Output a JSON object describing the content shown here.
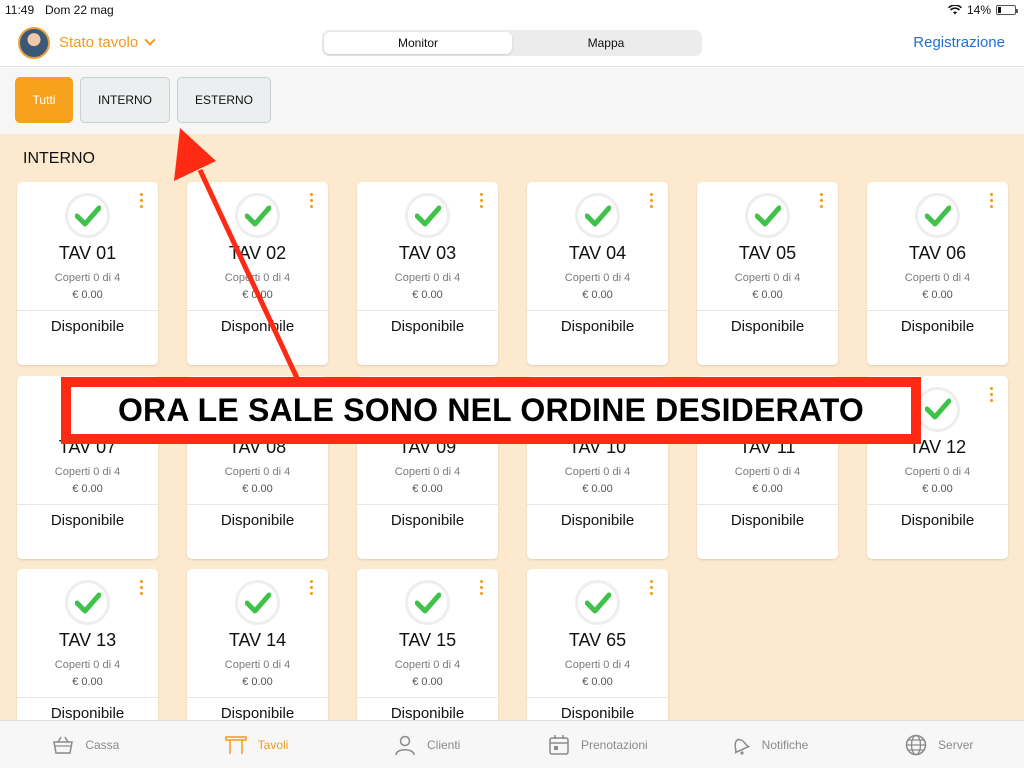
{
  "status_bar": {
    "time": "11:49",
    "date": "Dom 22 mag",
    "battery": "14%"
  },
  "header": {
    "title": "Stato tavolo",
    "segments": [
      {
        "label": "Monitor",
        "active": true
      },
      {
        "label": "Mappa",
        "active": false
      }
    ],
    "action": "Registrazione"
  },
  "filters": [
    {
      "label": "Tutti",
      "active": true
    },
    {
      "label": "INTERNO",
      "active": false
    },
    {
      "label": "ESTERNO",
      "active": false
    }
  ],
  "section": {
    "title": "INTERNO"
  },
  "tables": [
    {
      "name": "TAV 01",
      "coperti": "Coperti 0 di 4",
      "amount": "€ 0.00",
      "status": "Disponibile"
    },
    {
      "name": "TAV 02",
      "coperti": "Coperti 0 di 4",
      "amount": "€ 0.00",
      "status": "Disponibile"
    },
    {
      "name": "TAV 03",
      "coperti": "Coperti 0 di 4",
      "amount": "€ 0.00",
      "status": "Disponibile"
    },
    {
      "name": "TAV 04",
      "coperti": "Coperti 0 di 4",
      "amount": "€ 0.00",
      "status": "Disponibile"
    },
    {
      "name": "TAV 05",
      "coperti": "Coperti 0 di 4",
      "amount": "€ 0.00",
      "status": "Disponibile"
    },
    {
      "name": "TAV 06",
      "coperti": "Coperti 0 di 4",
      "amount": "€ 0.00",
      "status": "Disponibile"
    },
    {
      "name": "TAV 07",
      "coperti": "Coperti 0 di 4",
      "amount": "€ 0.00",
      "status": "Disponibile"
    },
    {
      "name": "TAV 08",
      "coperti": "Coperti 0 di 4",
      "amount": "€ 0.00",
      "status": "Disponibile"
    },
    {
      "name": "TAV 09",
      "coperti": "Coperti 0 di 4",
      "amount": "€ 0.00",
      "status": "Disponibile"
    },
    {
      "name": "TAV 10",
      "coperti": "Coperti 0 di 4",
      "amount": "€ 0.00",
      "status": "Disponibile"
    },
    {
      "name": "TAV 11",
      "coperti": "Coperti 0 di 4",
      "amount": "€ 0.00",
      "status": "Disponibile"
    },
    {
      "name": "TAV 12",
      "coperti": "Coperti 0 di 4",
      "amount": "€ 0.00",
      "status": "Disponibile"
    },
    {
      "name": "TAV 13",
      "coperti": "Coperti 0 di 4",
      "amount": "€ 0.00",
      "status": "Disponibile"
    },
    {
      "name": "TAV 14",
      "coperti": "Coperti 0 di 4",
      "amount": "€ 0.00",
      "status": "Disponibile"
    },
    {
      "name": "TAV 15",
      "coperti": "Coperti 0 di 4",
      "amount": "€ 0.00",
      "status": "Disponibile"
    },
    {
      "name": "TAV 65",
      "coperti": "Coperti 0 di 4",
      "amount": "€ 0.00",
      "status": "Disponibile"
    }
  ],
  "annotation": {
    "text": "ORA LE SALE SONO NEL ORDINE DESIDERATO"
  },
  "tabbar": [
    {
      "label": "Cassa",
      "icon": "basket-icon",
      "active": false
    },
    {
      "label": "Tavoli",
      "icon": "table-icon",
      "active": true
    },
    {
      "label": "Clienti",
      "icon": "person-icon",
      "active": false
    },
    {
      "label": "Prenotazioni",
      "icon": "calendar-icon",
      "active": false
    },
    {
      "label": "Notifiche",
      "icon": "bell-icon",
      "active": false
    },
    {
      "label": "Server",
      "icon": "globe-icon",
      "active": false
    }
  ],
  "colors": {
    "accent": "#f29a1d",
    "background": "#fde9ce",
    "check": "#3fc24a",
    "link": "#1e6fd9",
    "annotation": "#ff2a14"
  }
}
